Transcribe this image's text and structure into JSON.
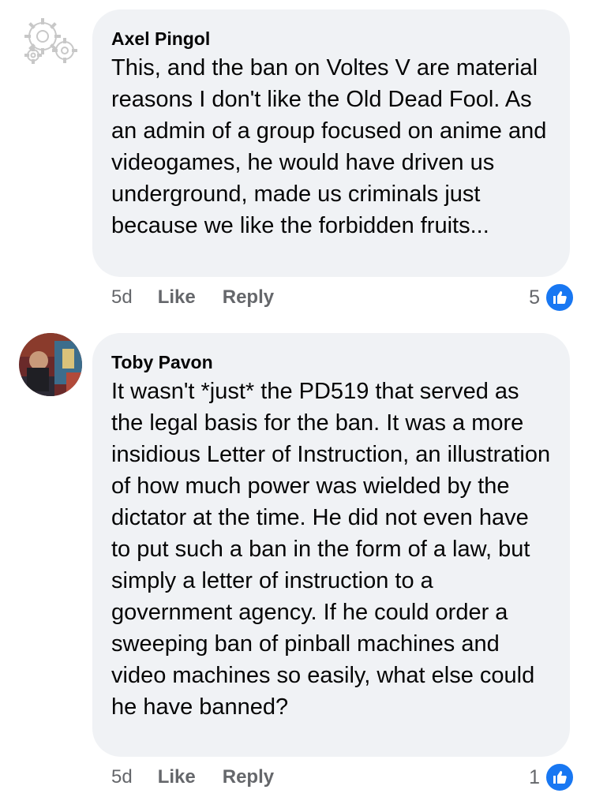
{
  "comments": [
    {
      "author": "Axel Pingol",
      "avatar_icon": "gears-default-avatar-icon",
      "text": "This, and the ban on Voltes V are material reasons I don't like the Old Dead Fool. As an admin of a group focused on anime and videogames, he would have driven us underground, made us criminals just because we like the forbidden fruits...",
      "time": "5d",
      "like_label": "Like",
      "reply_label": "Reply",
      "reaction_count": "5",
      "reaction_icon": "thumbs-up-icon"
    },
    {
      "author": "Toby Pavon",
      "avatar_icon": "profile-photo-avatar",
      "text": "It wasn't *just* the PD519 that served as the legal basis for the ban. It was a more insidious Letter of Instruction, an illustration of how much power was wielded by the dictator at the time. He did not even have to put such a ban in the form of a law, but simply a letter of instruction to a government agency. If he could order a sweeping ban of pinball machines and video machines so easily, what else could he have banned?",
      "time": "5d",
      "like_label": "Like",
      "reply_label": "Reply",
      "reaction_count": "1",
      "reaction_icon": "thumbs-up-icon"
    }
  ],
  "colors": {
    "bubble": "#f0f2f5",
    "meta_text": "#65676b",
    "like_blue": "#1877f2"
  }
}
